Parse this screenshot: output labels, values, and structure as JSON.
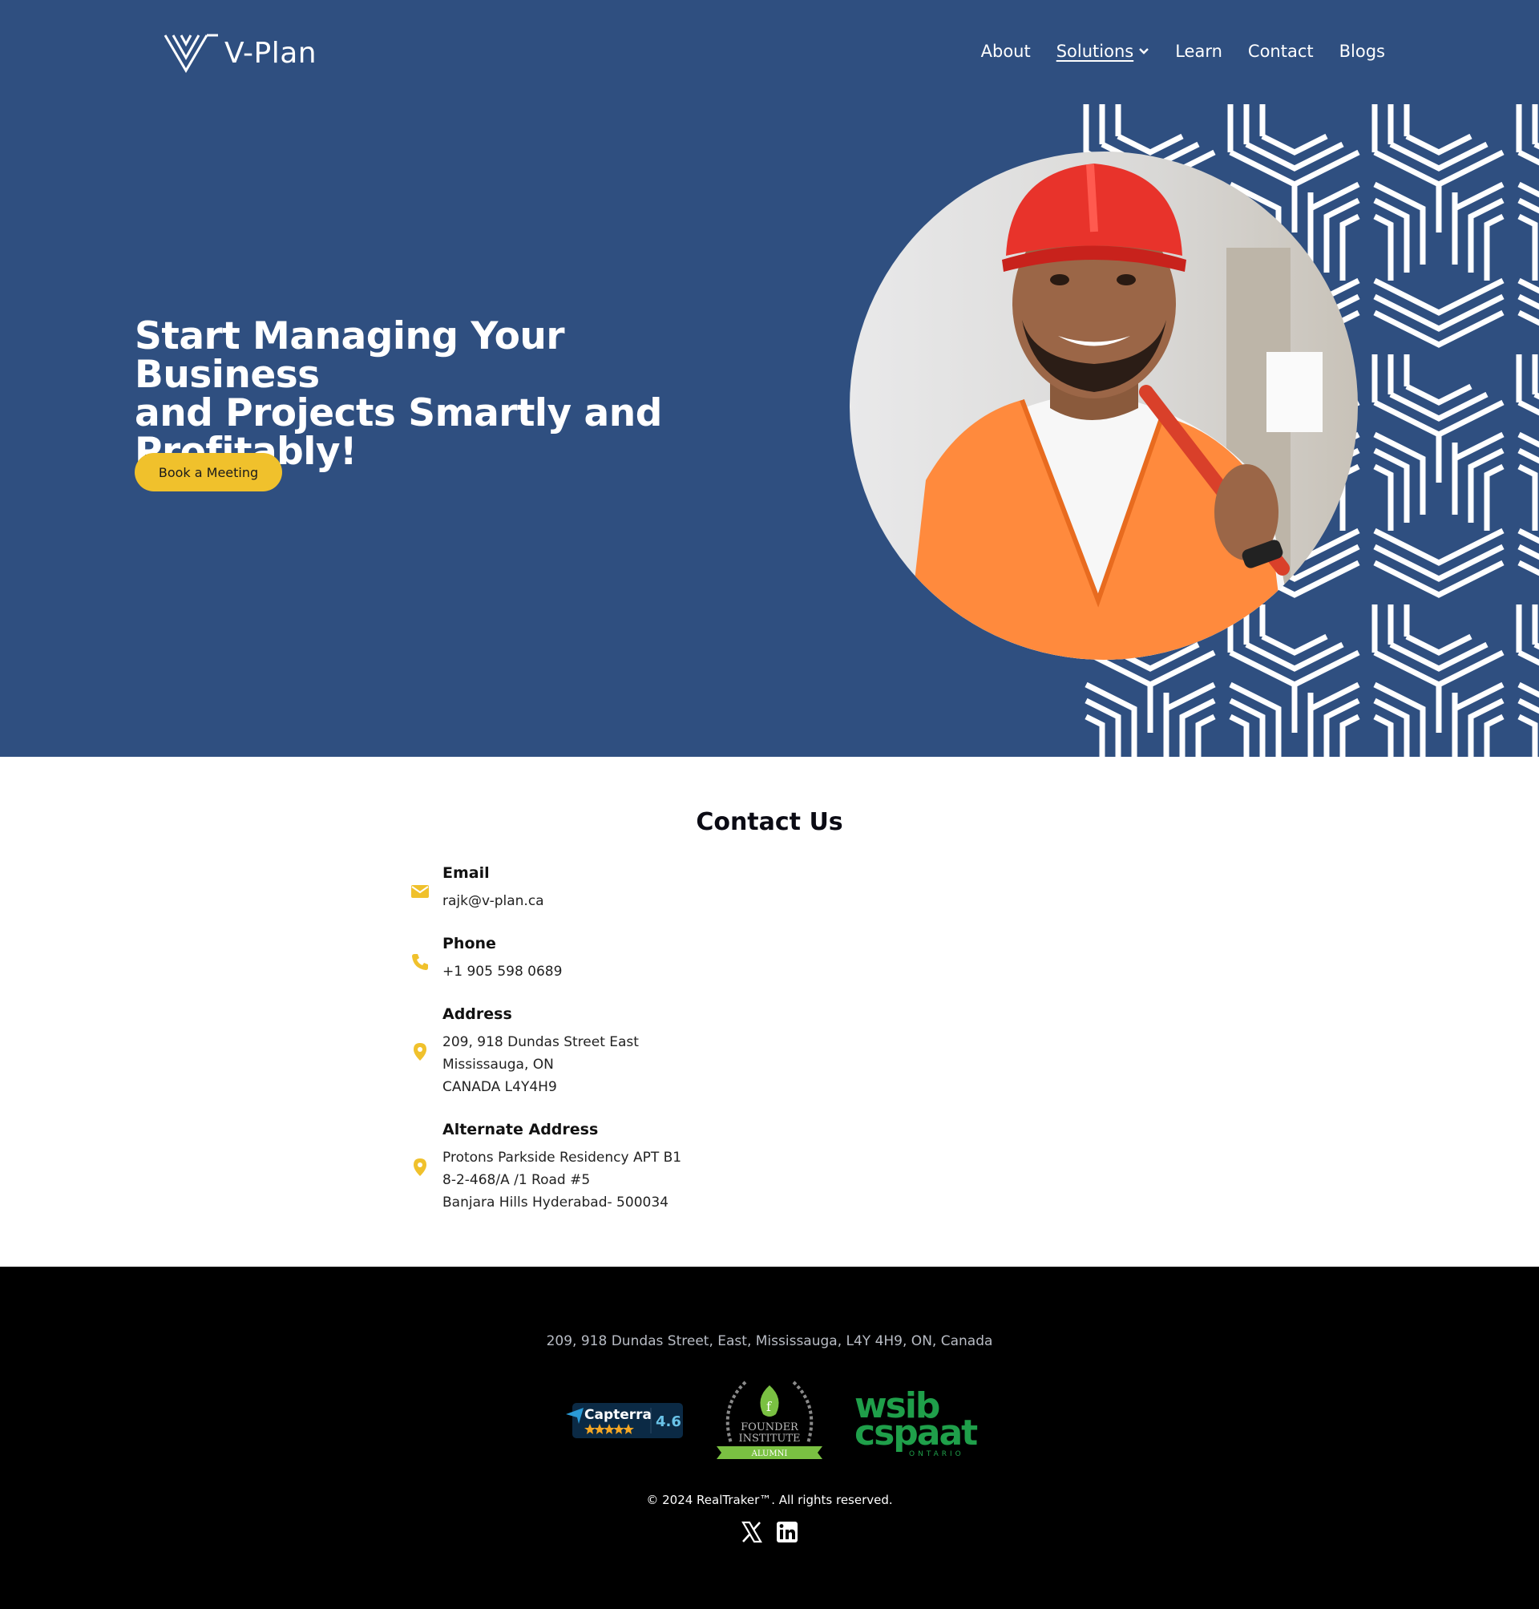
{
  "header": {
    "logo_text": "V-Plan",
    "nav": [
      {
        "label": "About"
      },
      {
        "label": "Solutions"
      },
      {
        "label": "Learn"
      },
      {
        "label": "Contact"
      },
      {
        "label": "Blogs"
      }
    ]
  },
  "hero": {
    "title_lines": [
      "Start Managing Your Business",
      "and Projects Smartly and",
      "Profitably!"
    ],
    "cta_label": "Book a Meeting"
  },
  "contact": {
    "title": "Contact Us",
    "email": {
      "label": "Email",
      "value": "rajk@v-plan.ca"
    },
    "phone": {
      "label": "Phone",
      "value": "+1 905 598 0689"
    },
    "address": {
      "label": "Address",
      "lines": [
        "209, 918 Dundas Street East",
        "Mississauga, ON",
        "CANADA L4Y4H9"
      ]
    },
    "alt_address": {
      "label": "Alternate Address",
      "lines": [
        "Protons Parkside Residency APT B1",
        "8-2-468/A /1 Road #5",
        "Banjara Hills Hyderabad- 500034"
      ]
    }
  },
  "footer": {
    "address": "209, 918 Dundas Street, East, Mississauga, L4Y 4H9, ON, Canada",
    "badges": {
      "capterra": {
        "name": "Capterra",
        "rating": "4.6"
      },
      "founder": {
        "line1": "FOUNDER",
        "line2": "INSTITUTE",
        "ribbon": "ALUMNI"
      },
      "wsib": {
        "line1": "wsib",
        "line2": "cspaat",
        "line3": "ONTARIO"
      }
    },
    "copyright": "© 2024 RealTraker™. All rights reserved.",
    "social": [
      "x-icon",
      "linkedin-icon"
    ]
  },
  "colors": {
    "hero_bg": "#2f4f80",
    "accent_yellow": "#f0c12c",
    "footer_bg": "#000000",
    "wsib_green": "#1f9f4a"
  }
}
